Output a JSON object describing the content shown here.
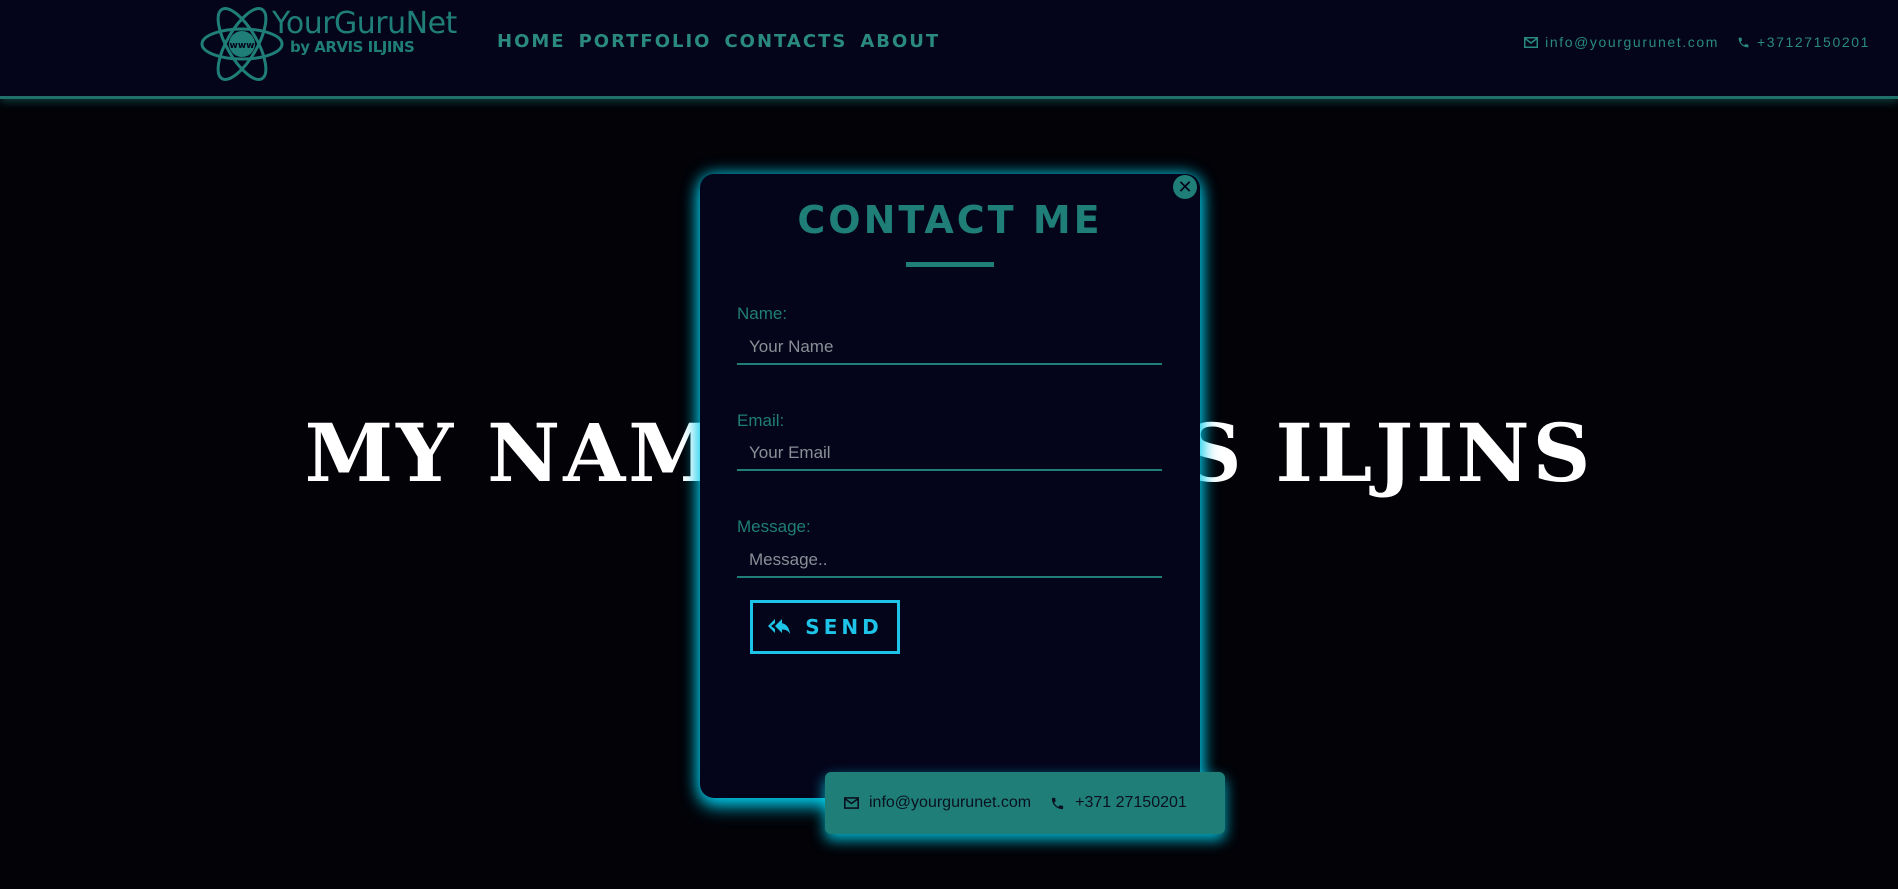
{
  "header": {
    "logo": {
      "title": "YourGuruNet",
      "subtitle": "by ARVIS ILJINS",
      "badge": "www"
    },
    "nav": [
      {
        "label": "HOME"
      },
      {
        "label": "PORTFOLIO"
      },
      {
        "label": "CONTACTS"
      },
      {
        "label": "ABOUT"
      }
    ],
    "contact": {
      "email": "info@yourgurunet.com",
      "phone": "+37127150201"
    }
  },
  "hero": {
    "title": "MY NAME IS ARVIS ILJINS"
  },
  "modal": {
    "title": "CONTACT ME",
    "close_icon": "close-icon",
    "fields": {
      "name": {
        "label": "Name:",
        "placeholder": "Your Name"
      },
      "email": {
        "label": "Email:",
        "placeholder": "Your Email"
      },
      "message": {
        "label": "Message:",
        "placeholder": "Message.."
      }
    },
    "send_label": "SEND"
  },
  "bottom_bar": {
    "email": "info@yourgurunet.com",
    "phone": "+371 27150201"
  },
  "colors": {
    "accent": "#1f7f78",
    "glow": "#1ec4e8",
    "background": "#020207",
    "panel": "#04041a"
  }
}
